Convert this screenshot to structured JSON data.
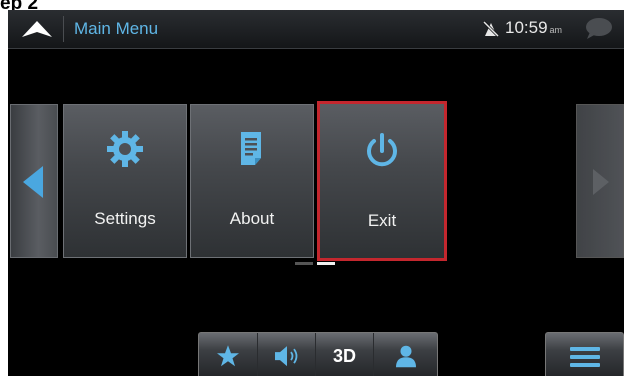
{
  "step_label": "ep 2",
  "header": {
    "title": "Main Menu",
    "time": "10:59",
    "ampm": "am",
    "icons": [
      "navigation-arrow-icon",
      "gps-off-icon",
      "message-bubble-icon"
    ]
  },
  "menu_tiles": [
    {
      "label": "Settings",
      "icon": "gear-icon",
      "selected": false
    },
    {
      "label": "About",
      "icon": "document-icon",
      "selected": false
    },
    {
      "label": "Exit",
      "icon": "power-icon",
      "selected": true
    }
  ],
  "pager": {
    "pages": 2,
    "current": 2
  },
  "toolbar": {
    "buttons": [
      {
        "icon": "star-icon"
      },
      {
        "icon": "speaker-icon"
      },
      {
        "label": "3D"
      },
      {
        "icon": "person-icon"
      }
    ]
  },
  "colors": {
    "title": "#5fb6e6",
    "accent_arrow": "#4aa7e0",
    "selection_border": "#c4272e"
  }
}
